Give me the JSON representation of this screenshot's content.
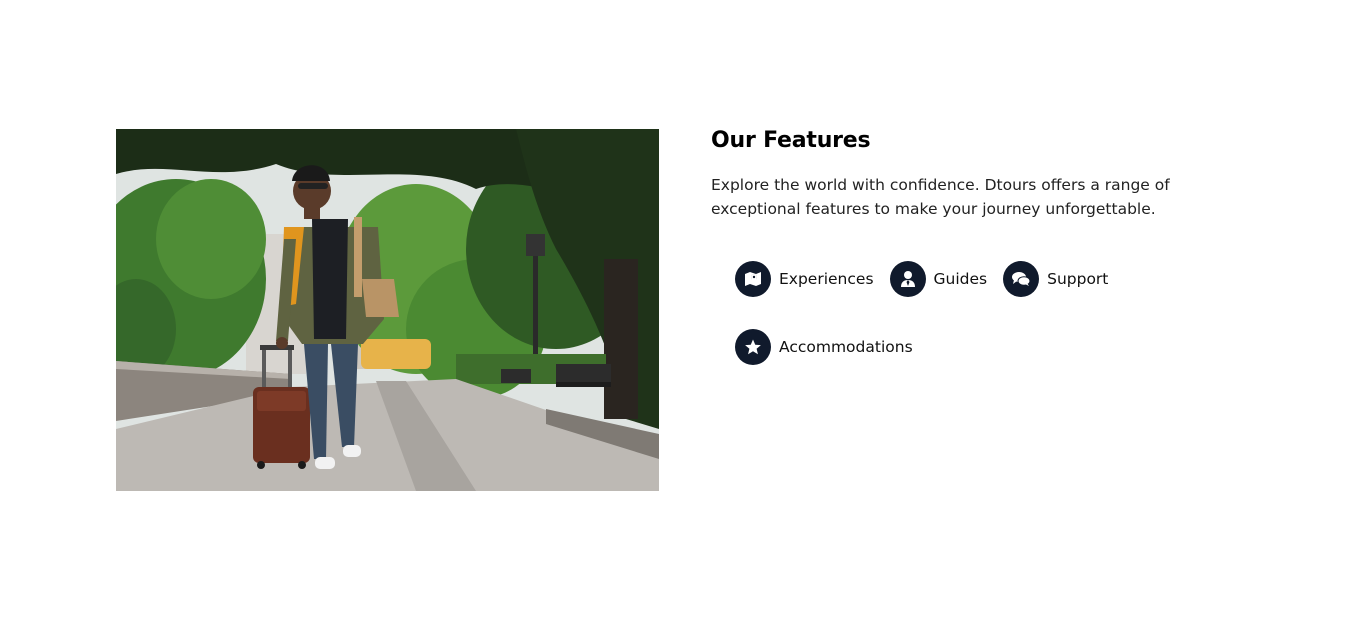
{
  "features_section": {
    "title": "Our Features",
    "description": "Explore the world with confidence. Dtours offers a range of exceptional features to make your journey unforgettable.",
    "items": [
      {
        "label": "Experiences",
        "icon": "map-marker-icon"
      },
      {
        "label": "Guides",
        "icon": "user-tie-icon"
      },
      {
        "label": "Support",
        "icon": "chat-bubbles-icon"
      },
      {
        "label": "Accommodations",
        "icon": "star-icon"
      }
    ],
    "icon_bg_color": "#101a2c",
    "image_alt": "Traveler walking with rolling suitcase in a park"
  }
}
